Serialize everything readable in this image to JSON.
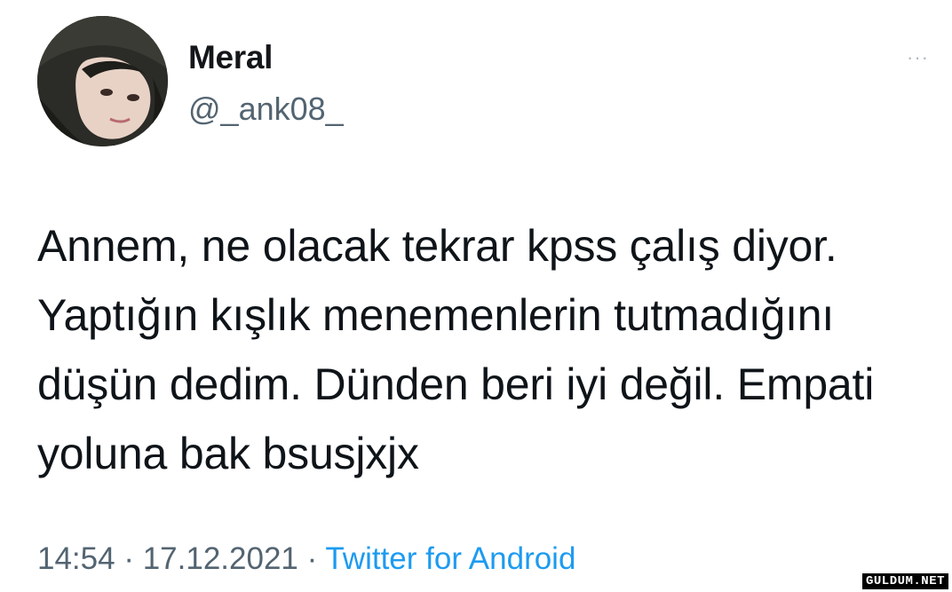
{
  "user": {
    "display_name": "Meral",
    "handle": "@_ank08_"
  },
  "more_button": "···",
  "tweet_text": "Annem, ne olacak tekrar kpss çalış diyor. Yaptığın kışlık menemenlerin tutmadığını düşün dedim. Dünden beri iyi değil. Empati yoluna bak bsusjxjx",
  "meta": {
    "time": "14:54",
    "separator": " · ",
    "date": "17.12.2021",
    "source": "Twitter for Android"
  },
  "watermark": "GULDUM.NET",
  "colors": {
    "name": "#14171a",
    "secondary": "#536471",
    "link": "#1d9bf0",
    "text": "#0f1419"
  }
}
